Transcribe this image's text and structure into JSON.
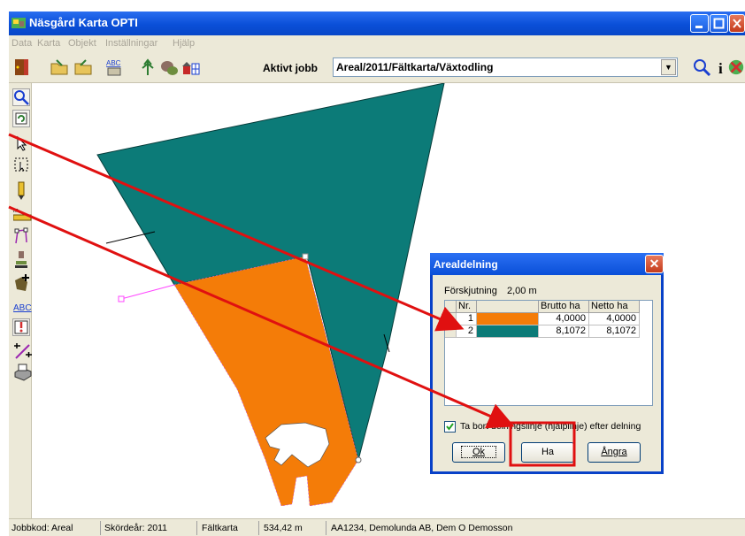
{
  "window": {
    "title": "Näsgård Karta OPTI"
  },
  "menu": [
    "Data",
    "Karta",
    "Objekt",
    "Inställningar",
    "Hjälp"
  ],
  "toolbar": {
    "job_label": "Aktivt jobb",
    "job_value": "Areal/2011/Fältkarta/Växtodling"
  },
  "left_tools": [
    "zoom-icon",
    "refresh-icon",
    "pointer-icon",
    "select-area-icon",
    "pen-icon",
    "ruler-icon",
    "polyline-icon",
    "stamp-icon",
    "add-field-icon",
    "text-abc-icon",
    "marker-icon",
    "split-tool-icon",
    "print-icon"
  ],
  "left_tools_abc_label": "ABC",
  "dialog": {
    "title": "Arealdelning",
    "offset_label": "Förskjutning",
    "offset_value": "2,00 m",
    "columns": [
      "Nr.",
      "",
      "Brutto ha",
      "Netto ha"
    ],
    "rows": [
      {
        "nr": "1",
        "color": "#f47c08",
        "brutto": "4,0000",
        "netto": "4,0000"
      },
      {
        "nr": "2",
        "color": "#0c7b78",
        "brutto": "8,1072",
        "netto": "8,1072"
      }
    ],
    "checkbox_label": "Ta bort delningslinje (hjälplinje) efter delning",
    "checkbox_checked": true,
    "ok_button": "Ok",
    "ha_button": "Ha",
    "undo_button": "Ångra"
  },
  "status": {
    "job_code": "Jobbkod: Areal",
    "harvest_year": "Skördeår: 2011",
    "map_type": "Fältkarta",
    "measure": "534,42 m",
    "customer": "AA1234, Demolunda AB, Dem O Demosson"
  },
  "colors": {
    "teal": "#0c7b78",
    "orange": "#f47c08",
    "annotation": "#e01010",
    "split_line": "#ff44ff"
  }
}
